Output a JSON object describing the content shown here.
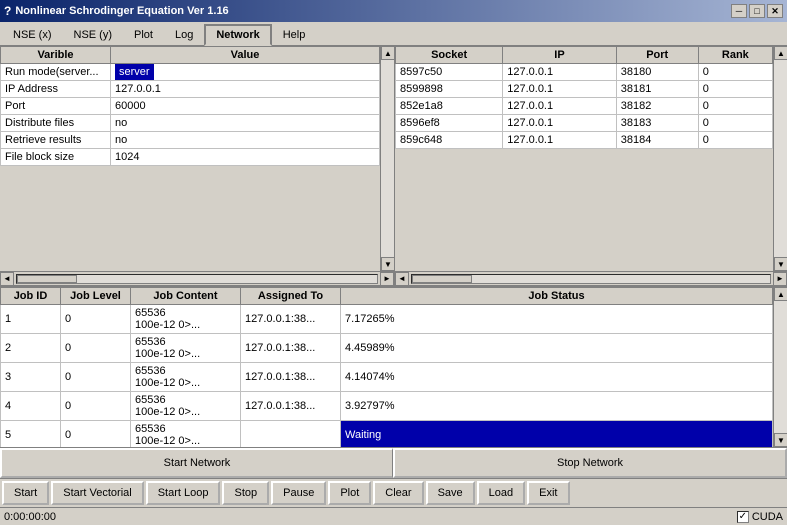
{
  "titleBar": {
    "title": "Nonlinear Schrodinger Equation Ver 1.16",
    "icon": "◈",
    "minBtn": "─",
    "maxBtn": "□",
    "closeBtn": "✕",
    "sysIcon": "?"
  },
  "menuBar": {
    "items": [
      {
        "label": "NSE (x)",
        "active": false
      },
      {
        "label": "NSE (y)",
        "active": false
      },
      {
        "label": "Plot",
        "active": false
      },
      {
        "label": "Log",
        "active": false
      },
      {
        "label": "Network",
        "active": true
      },
      {
        "label": "Help",
        "active": false
      }
    ]
  },
  "leftTable": {
    "headers": [
      "Varible",
      "Value"
    ],
    "rows": [
      {
        "varible": "Run mode(server...",
        "value": "server",
        "highlight": true
      },
      {
        "varible": "IP Address",
        "value": "127.0.0.1",
        "highlight": false
      },
      {
        "varible": "Port",
        "value": "60000",
        "highlight": false
      },
      {
        "varible": "Distribute files",
        "value": "no",
        "highlight": false
      },
      {
        "varible": "Retrieve results",
        "value": "no",
        "highlight": false
      },
      {
        "varible": "File block size",
        "value": "1024",
        "highlight": false
      }
    ]
  },
  "rightTable": {
    "headers": [
      "Socket",
      "IP",
      "Port",
      "Rank"
    ],
    "rows": [
      {
        "socket": "8597c50",
        "ip": "127.0.0.1",
        "port": "38180",
        "rank": "0"
      },
      {
        "socket": "8599898",
        "ip": "127.0.0.1",
        "port": "38181",
        "rank": "0"
      },
      {
        "socket": "852e1a8",
        "ip": "127.0.0.1",
        "port": "38182",
        "rank": "0"
      },
      {
        "socket": "8596ef8",
        "ip": "127.0.0.1",
        "port": "38183",
        "rank": "0"
      },
      {
        "socket": "859c648",
        "ip": "127.0.0.1",
        "port": "38184",
        "rank": "0"
      }
    ]
  },
  "jobsTable": {
    "headers": [
      "Job ID",
      "Job Level",
      "Job Content",
      "Assigned To",
      "Job Status"
    ],
    "rows": [
      {
        "id": "1",
        "level": "0",
        "content": "65536\n100e-12 0>...",
        "assigned": "127.0.0.1:38...",
        "status": "7.17265%",
        "waiting": false
      },
      {
        "id": "2",
        "level": "0",
        "content": "65536\n100e-12 0>...",
        "assigned": "127.0.0.1:38...",
        "status": "4.45989%",
        "waiting": false
      },
      {
        "id": "3",
        "level": "0",
        "content": "65536\n100e-12 0>...",
        "assigned": "127.0.0.1:38...",
        "status": "4.14074%",
        "waiting": false
      },
      {
        "id": "4",
        "level": "0",
        "content": "65536\n100e-12 0>...",
        "assigned": "127.0.0.1:38...",
        "status": "3.92797%",
        "waiting": false
      },
      {
        "id": "5",
        "level": "0",
        "content": "65536\n100e-12 0>...",
        "assigned": "",
        "status": "Waiting",
        "waiting": true
      }
    ]
  },
  "bottomBtns": {
    "startNetwork": "Start Network",
    "stopNetwork": "Stop Network"
  },
  "actionBar": {
    "buttons": [
      "Start",
      "Start Vectorial",
      "Start Loop",
      "Stop",
      "Pause",
      "Plot",
      "Clear",
      "Save",
      "Load",
      "Exit"
    ]
  },
  "statusBar": {
    "time": "0:00:00:00",
    "cuda": "CUDA",
    "cudaChecked": true
  }
}
